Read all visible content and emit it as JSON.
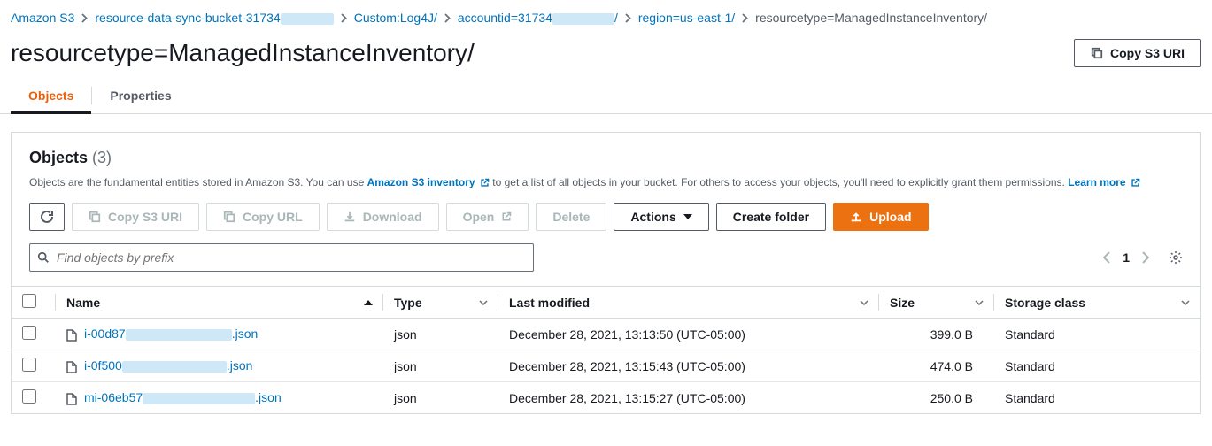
{
  "breadcrumbs": [
    {
      "label": "Amazon S3",
      "href": true
    },
    {
      "label": "resource-data-sync-bucket-31734",
      "redact_after": 60,
      "href": true
    },
    {
      "label": "Custom:Log4J/",
      "href": true
    },
    {
      "label": "accountid=31734",
      "redact_after": 70,
      "trailing": "/",
      "href": true
    },
    {
      "label": "region=us-east-1/",
      "href": true
    },
    {
      "label": "resourcetype=ManagedInstanceInventory/",
      "current": true
    }
  ],
  "page_title": "resourcetype=ManagedInstanceInventory/",
  "header_button": "Copy S3 URI",
  "tabs": {
    "objects": "Objects",
    "properties": "Properties"
  },
  "section": {
    "title": "Objects",
    "count": "(3)",
    "desc_before": "Objects are the fundamental entities stored in Amazon S3. You can use ",
    "desc_link1": "Amazon S3 inventory",
    "desc_mid": " to get a list of all objects in your bucket. For others to access your objects, you'll need to explicitly grant them permissions. ",
    "desc_link2": "Learn more"
  },
  "toolbar": {
    "copy_s3_uri": "Copy S3 URI",
    "copy_url": "Copy URL",
    "download": "Download",
    "open": "Open",
    "delete": "Delete",
    "actions": "Actions",
    "create_folder": "Create folder",
    "upload": "Upload"
  },
  "search": {
    "placeholder": "Find objects by prefix"
  },
  "pagination": {
    "page": "1"
  },
  "columns": {
    "name": "Name",
    "type": "Type",
    "last_modified": "Last modified",
    "size": "Size",
    "storage_class": "Storage class"
  },
  "rows": [
    {
      "name_prefix": "i-00d87",
      "name_suffix": ".json",
      "redact": 120,
      "type": "json",
      "modified": "December 28, 2021, 13:13:50 (UTC-05:00)",
      "size": "399.0 B",
      "storage": "Standard"
    },
    {
      "name_prefix": "i-0f500",
      "name_suffix": ".json",
      "redact": 118,
      "type": "json",
      "modified": "December 28, 2021, 13:15:43 (UTC-05:00)",
      "size": "474.0 B",
      "storage": "Standard"
    },
    {
      "name_prefix": "mi-06eb57",
      "name_suffix": ".json",
      "redact": 127,
      "type": "json",
      "modified": "December 28, 2021, 13:15:27 (UTC-05:00)",
      "size": "250.0 B",
      "storage": "Standard"
    }
  ]
}
